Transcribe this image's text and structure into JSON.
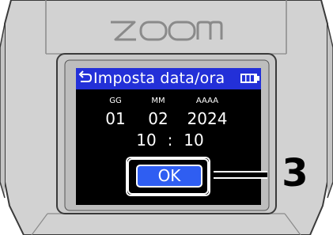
{
  "device": {
    "logo": "ZOOM"
  },
  "screen": {
    "title": "Imposta data/ora",
    "back_icon": "back-arrow-icon",
    "battery_icon": "battery-icon",
    "date": [
      {
        "label": "GG",
        "value": "01"
      },
      {
        "label": "MM",
        "value": "02"
      },
      {
        "label": "AAAA",
        "value": "2024"
      }
    ],
    "time": {
      "hours": "10",
      "separator": ":",
      "minutes": "10"
    },
    "ok_label": "OK"
  },
  "callout": {
    "number": "3"
  },
  "colors": {
    "header_bg": "#2330d8",
    "ok_button": "#2f5ef2",
    "device_body": "#d2d2d2"
  }
}
